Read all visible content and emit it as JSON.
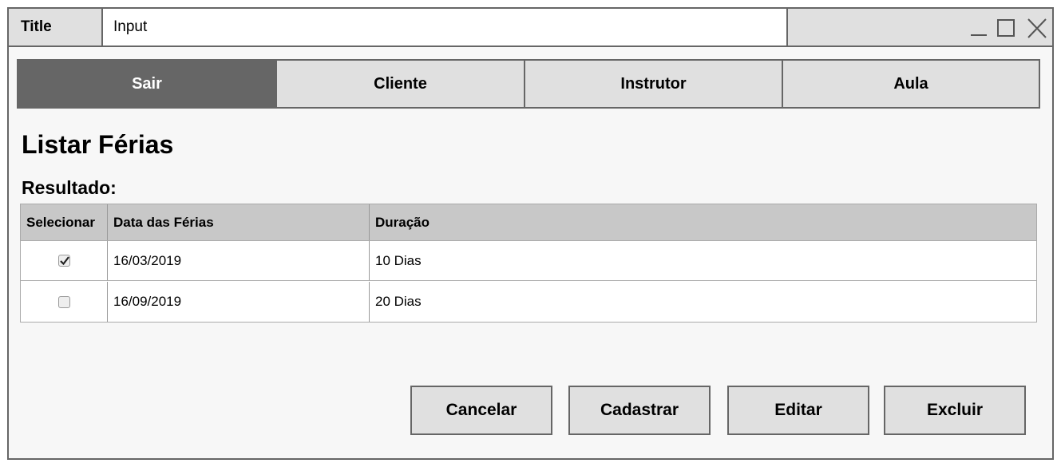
{
  "window": {
    "title_label": "Title",
    "title_input": "Input"
  },
  "nav": {
    "tabs": [
      {
        "label": "Sair",
        "active": true
      },
      {
        "label": "Cliente",
        "active": false
      },
      {
        "label": "Instrutor",
        "active": false
      },
      {
        "label": "Aula",
        "active": false
      }
    ]
  },
  "page": {
    "title": "Listar Férias",
    "result_label": "Resultado:"
  },
  "table": {
    "headers": [
      "Selecionar",
      "Data das Férias",
      "Duração"
    ],
    "rows": [
      {
        "selected": true,
        "date": "16/03/2019",
        "duration": "10 Dias"
      },
      {
        "selected": false,
        "date": "16/09/2019",
        "duration": "20 Dias"
      }
    ]
  },
  "actions": {
    "cancel": "Cancelar",
    "create": "Cadastrar",
    "edit": "Editar",
    "delete": "Excluir"
  },
  "colors": {
    "active_tab": "#666666",
    "tab_bg": "#e0e0e0",
    "header_bg": "#c8c8c8"
  }
}
